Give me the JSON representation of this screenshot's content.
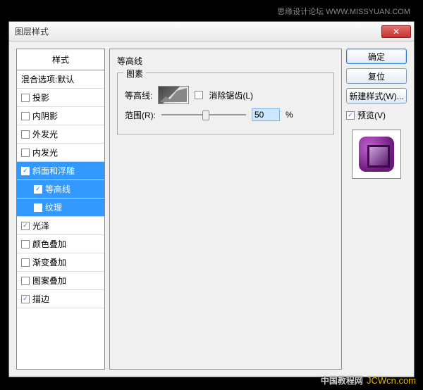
{
  "watermark_top": "思缘设计论坛 WWW.MISSYUAN.COM",
  "watermark_bottom_cn": "中国教程网",
  "watermark_bottom_com": "JCWcn.com",
  "dialog": {
    "title": "图层样式"
  },
  "styles_panel": {
    "header": "样式",
    "blending": "混合选项:默认",
    "items": [
      {
        "label": "投影",
        "checked": false,
        "sub": false
      },
      {
        "label": "内阴影",
        "checked": false,
        "sub": false
      },
      {
        "label": "外发光",
        "checked": false,
        "sub": false
      },
      {
        "label": "内发光",
        "checked": false,
        "sub": false
      },
      {
        "label": "斜面和浮雕",
        "checked": true,
        "sub": false,
        "selected": true
      },
      {
        "label": "等高线",
        "checked": true,
        "sub": true,
        "selected": true
      },
      {
        "label": "纹理",
        "checked": false,
        "sub": true,
        "selected": true
      },
      {
        "label": "光泽",
        "checked": true,
        "sub": false
      },
      {
        "label": "颜色叠加",
        "checked": false,
        "sub": false
      },
      {
        "label": "渐变叠加",
        "checked": false,
        "sub": false
      },
      {
        "label": "图案叠加",
        "checked": false,
        "sub": false
      },
      {
        "label": "描边",
        "checked": true,
        "sub": false
      }
    ]
  },
  "contour_panel": {
    "title": "等高线",
    "group": "图素",
    "contour_label": "等高线:",
    "antialias_label": "消除锯齿(L)",
    "antialias_checked": false,
    "range_label": "范围(R):",
    "range_value": "50",
    "percent": "%"
  },
  "right": {
    "ok": "确定",
    "cancel": "复位",
    "new_style": "新建样式(W)...",
    "preview_label": "预览(V)",
    "preview_checked": true
  }
}
